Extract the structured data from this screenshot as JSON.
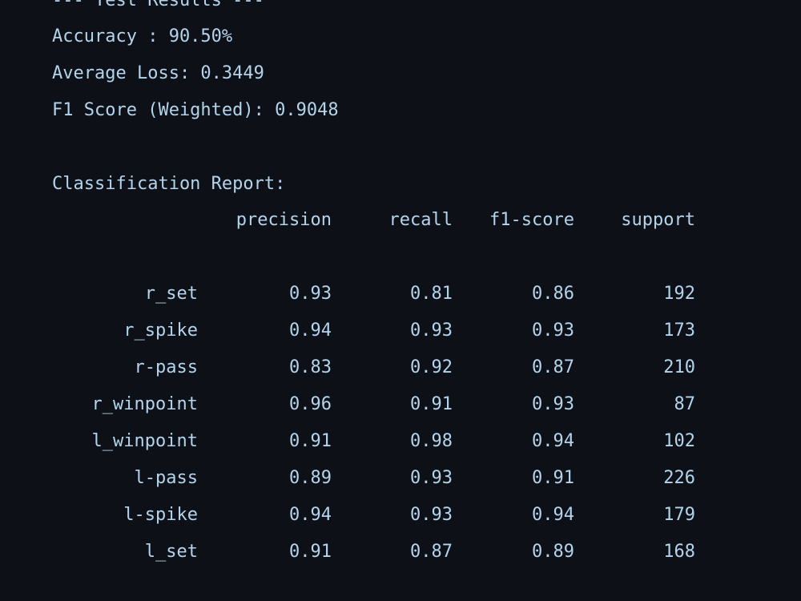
{
  "header_line": "--- Test Results ---",
  "metrics": {
    "accuracy": "Accuracy : 90.50%",
    "avg_loss": "Average Loss: 0.3449",
    "f1_weighted": "F1 Score (Weighted): 0.9048"
  },
  "report": {
    "title": "Classification Report:",
    "columns": [
      "precision",
      "recall",
      "f1-score",
      "support"
    ],
    "rows": [
      {
        "label": "r_set",
        "precision": "0.93",
        "recall": "0.81",
        "f1": "0.86",
        "support": "192"
      },
      {
        "label": "r_spike",
        "precision": "0.94",
        "recall": "0.93",
        "f1": "0.93",
        "support": "173"
      },
      {
        "label": "r-pass",
        "precision": "0.83",
        "recall": "0.92",
        "f1": "0.87",
        "support": "210"
      },
      {
        "label": "r_winpoint",
        "precision": "0.96",
        "recall": "0.91",
        "f1": "0.93",
        "support": "87"
      },
      {
        "label": "l_winpoint",
        "precision": "0.91",
        "recall": "0.98",
        "f1": "0.94",
        "support": "102"
      },
      {
        "label": "l-pass",
        "precision": "0.89",
        "recall": "0.93",
        "f1": "0.91",
        "support": "226"
      },
      {
        "label": "l-spike",
        "precision": "0.94",
        "recall": "0.93",
        "f1": "0.94",
        "support": "179"
      },
      {
        "label": "l_set",
        "precision": "0.91",
        "recall": "0.87",
        "f1": "0.89",
        "support": "168"
      }
    ]
  }
}
